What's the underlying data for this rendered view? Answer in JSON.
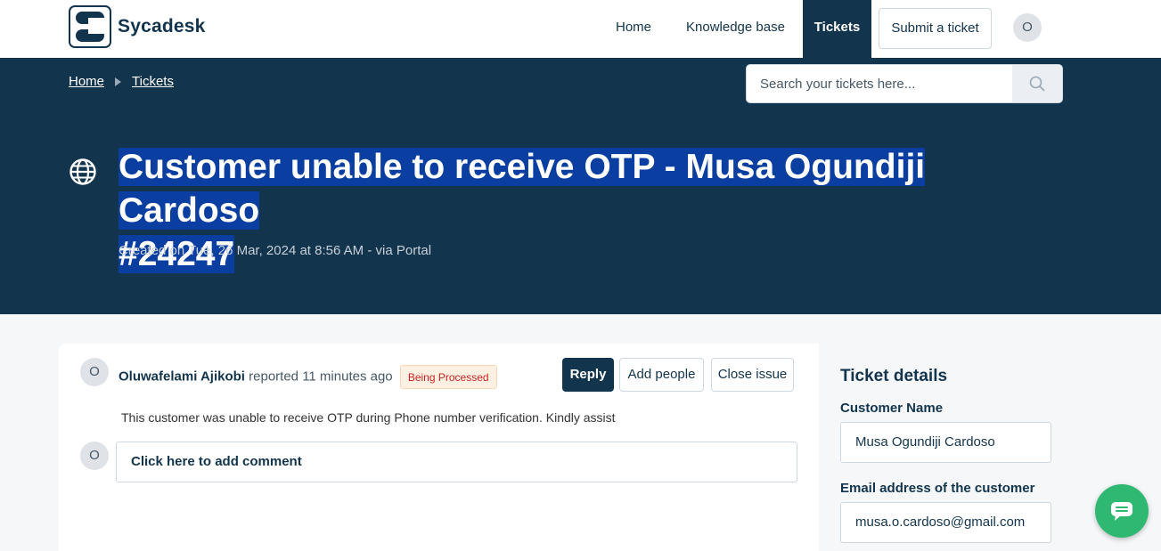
{
  "brand": {
    "name": "Sycadesk"
  },
  "nav": {
    "home": "Home",
    "knowledge_base": "Knowledge base",
    "tickets": "Tickets",
    "submit": "Submit a ticket",
    "user_initial": "O"
  },
  "breadcrumb": {
    "home": "Home",
    "tickets": "Tickets"
  },
  "search": {
    "placeholder": "Search your tickets here..."
  },
  "ticket": {
    "title_line1": "Customer unable to receive OTP - Musa Ogundiji Cardoso",
    "title_line2": "#24247",
    "created": "Created on Tue, 26 Mar, 2024 at 8:56 AM - via Portal",
    "reporter_name": "Oluwafelami Ajikobi",
    "reported_text": "reported 11 minutes ago",
    "reporter_initial": "O",
    "status": "Being Processed",
    "description": "This customer was unable to receive OTP during Phone number verification. Kindly assist",
    "comment_placeholder": "Click here to add comment",
    "commenter_initial": "O"
  },
  "actions": {
    "reply": "Reply",
    "add_people": "Add people",
    "close_issue": "Close issue"
  },
  "details": {
    "title": "Ticket details",
    "customer_name_label": "Customer Name",
    "customer_name": "Musa Ogundiji Cardoso",
    "email_label": "Email address of the customer",
    "email": "musa.o.cardoso@gmail.com"
  },
  "colors": {
    "primary": "#12344d",
    "selection": "#0a3ea0",
    "chat": "#2fb872",
    "badge_text": "#c82124"
  }
}
